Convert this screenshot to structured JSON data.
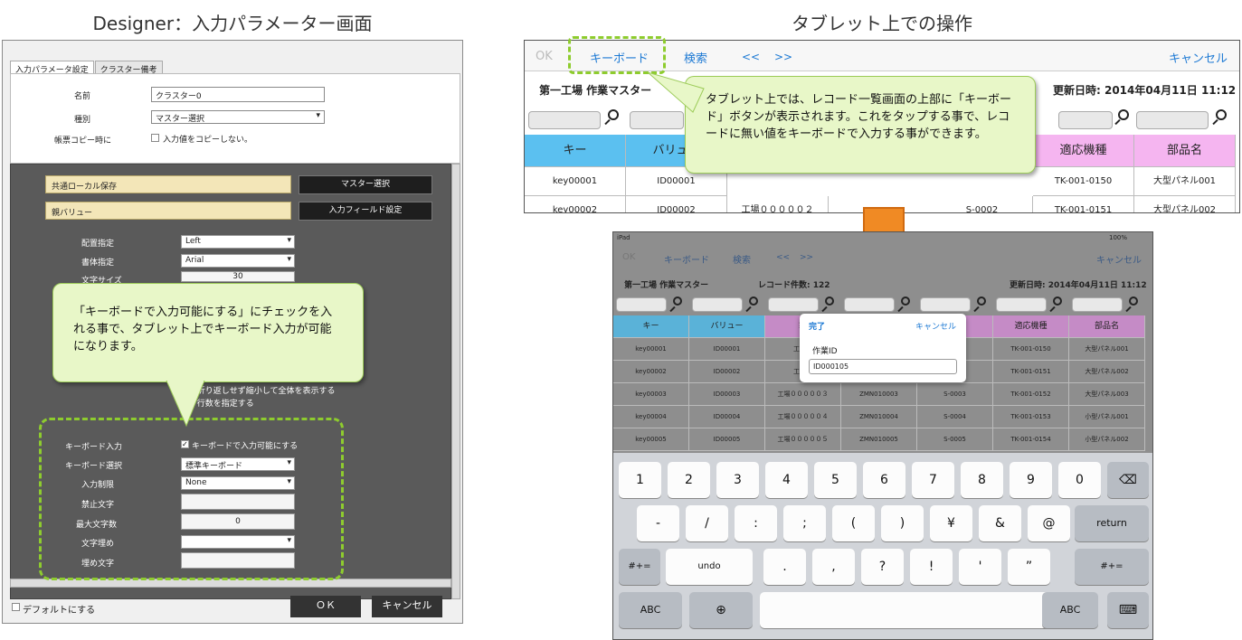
{
  "headers": {
    "left": "Designer：入力パラメーター画面",
    "right": "タブレット上での操作"
  },
  "designer": {
    "tabs": [
      "入力パラメータ設定",
      "クラスター備考"
    ],
    "name_label": "名前",
    "name_value": "クラスター0",
    "type_label": "種別",
    "type_value": "マスター選択",
    "copy_label": "帳票コピー時に",
    "copy_check": "入力値をコピーしない。",
    "common_local": "共通ローカル保存",
    "master_select_btn": "マスター選択",
    "parent_value": "親バリュー",
    "input_field_btn": "入力フィールド設定",
    "align_label": "配置指定",
    "align_value": "Left",
    "font_label": "書体指定",
    "font_value": "Arial",
    "size_label": "文字サイズ",
    "size_value": "30",
    "fit_text": "折り返しせず縮小して全体を表示する",
    "rows_text": "行数を指定する",
    "kb_input_label": "キーボード入力",
    "kb_input_check": "キーボードで入力可能にする",
    "kb_select_label": "キーボード選択",
    "kb_select_value": "標準キーボード",
    "limit_label": "入力制限",
    "limit_value": "None",
    "forbid_label": "禁止文字",
    "maxlen_label": "最大文字数",
    "maxlen_value": "0",
    "pad_label": "文字埋め",
    "fill_label": "埋め文字",
    "default_check": "デフォルトにする",
    "ok_btn": "ＯＫ",
    "cancel_btn": "キャンセル",
    "callout": "「キーボードで入力可能にする」にチェックを入れる事で、タブレット上でキーボード入力が可能になります。"
  },
  "tablet": {
    "ok": "OK",
    "keyboard": "キーボード",
    "search": "検索",
    "prev": "<<",
    "next": ">>",
    "cancel": "キャンセル",
    "title": "第一工場 作業マスター",
    "updated": "更新日時: 2014年04月11日 11:12",
    "col_key": "キー",
    "col_value": "バリュー",
    "col_model": "適応機種",
    "col_part": "部品名",
    "row1": [
      "key00001",
      "ID00001",
      "TK-001-0150",
      "大型パネル001"
    ],
    "row2": [
      "key00002",
      "ID00002",
      "工場０００００２",
      "S-0002",
      "TK-001-0151",
      "大型パネル002"
    ],
    "callout": "タブレット上では、レコード一覧画面の上部に「キーボード」ボタンが表示されます。これをタップする事で、レコードに無い値をキーボードで入力する事ができます。"
  },
  "ipad": {
    "status_left": "iPad",
    "status_right": "100%",
    "keyboard": "キーボード",
    "search": "検索",
    "prev": "<<",
    "next": ">>",
    "cancel": "キャンセル",
    "ok": "OK",
    "title": "第一工場 作業マスター",
    "count": "レコード件数: 122",
    "updated": "更新日時: 2014年04月11日 11:12",
    "cols": [
      "キー",
      "バリュー",
      "製",
      "",
      "",
      "適応機種",
      "部品名"
    ],
    "rows": [
      [
        "key00001",
        "ID00001",
        "工場０",
        "",
        "",
        "TK-001-0150",
        "大型パネル001"
      ],
      [
        "key00002",
        "ID00002",
        "工場０",
        "",
        "",
        "TK-001-0151",
        "大型パネル002"
      ],
      [
        "key00003",
        "ID00003",
        "工場０００００３",
        "ZMN010003",
        "S-0003",
        "TK-001-0152",
        "大型パネル003"
      ],
      [
        "key00004",
        "ID00004",
        "工場０００００４",
        "ZMN010004",
        "S-0004",
        "TK-001-0153",
        "小型パネル001"
      ],
      [
        "key00005",
        "ID00005",
        "工場０００００５",
        "ZMN010005",
        "S-0005",
        "TK-001-0154",
        "小型パネル002"
      ]
    ],
    "popup_done": "完了",
    "popup_cancel": "キャンセル",
    "popup_label": "作業ID",
    "popup_value": "ID000105",
    "keys_row1": [
      "1",
      "2",
      "3",
      "4",
      "5",
      "6",
      "7",
      "8",
      "9",
      "0"
    ],
    "keys_row2": [
      "-",
      "/",
      ":",
      ";",
      "(",
      ")",
      "¥",
      "&",
      "@"
    ],
    "return": "return",
    "keys_row3": [
      "#+=",
      "undo",
      ".",
      ",",
      "?",
      "!",
      "'",
      "”",
      "#+="
    ],
    "abc": "ABC"
  }
}
